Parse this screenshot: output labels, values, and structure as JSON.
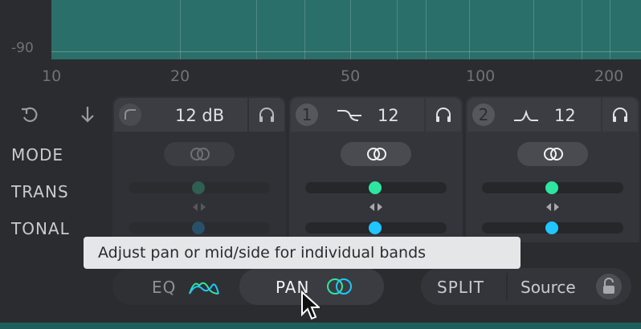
{
  "spectrum": {
    "db_label": "-90",
    "freq_labels": [
      "10",
      "20",
      "50",
      "100",
      "200"
    ]
  },
  "controls": {
    "reset_icon": "rotate-ccw-icon",
    "down_icon": "arrow-down-icon"
  },
  "rows": {
    "mode": "MODE",
    "trans": "TRANS",
    "tonal": "TONAL"
  },
  "bands": [
    {
      "number": "",
      "shape": "low-shelf-icon",
      "value": "12 dB",
      "dimmed": true,
      "trans_level": 0.5,
      "tonal_level": 0.5
    },
    {
      "number": "1",
      "shape": "crossover-icon",
      "value": "12",
      "dimmed": false,
      "trans_level": 0.5,
      "tonal_level": 0.5
    },
    {
      "number": "2",
      "shape": "peak-icon",
      "value": "12",
      "dimmed": false,
      "trans_level": 0.5,
      "tonal_level": 0.5
    }
  ],
  "tooltip": "Adjust pan or mid/side for individual bands",
  "view_tabs": {
    "eq": "EQ",
    "pan": "PAN",
    "active": "PAN"
  },
  "split": {
    "split_label": "SPLIT",
    "source_label": "Source"
  },
  "colors": {
    "teal": "#2b6f6a",
    "green_knob": "#2ee6a0",
    "blue_knob": "#1fc6ff"
  }
}
